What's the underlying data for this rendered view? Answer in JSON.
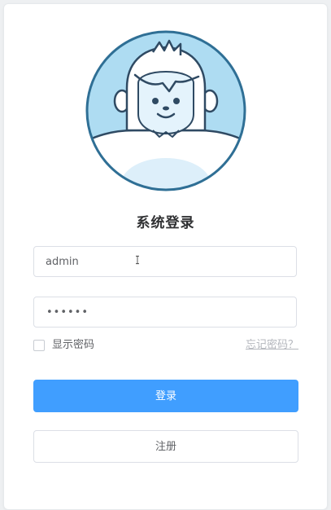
{
  "login": {
    "title": "系统登录",
    "username": {
      "value": "admin",
      "placeholder": ""
    },
    "password": {
      "masked_value": "••••••"
    },
    "show_password_label": "显示密码",
    "show_password_checked": false,
    "forgot_password_label": "忘记密码？",
    "login_button_label": "登录",
    "register_button_label": "注册"
  },
  "colors": {
    "primary": "#409eff",
    "avatar_ring": "#2f6f95",
    "avatar_bg": "#aedcf2",
    "face": "#e4f3fc"
  },
  "icons": {
    "avatar": "yeti-avatar-icon",
    "cursor": "text-cursor-icon"
  }
}
